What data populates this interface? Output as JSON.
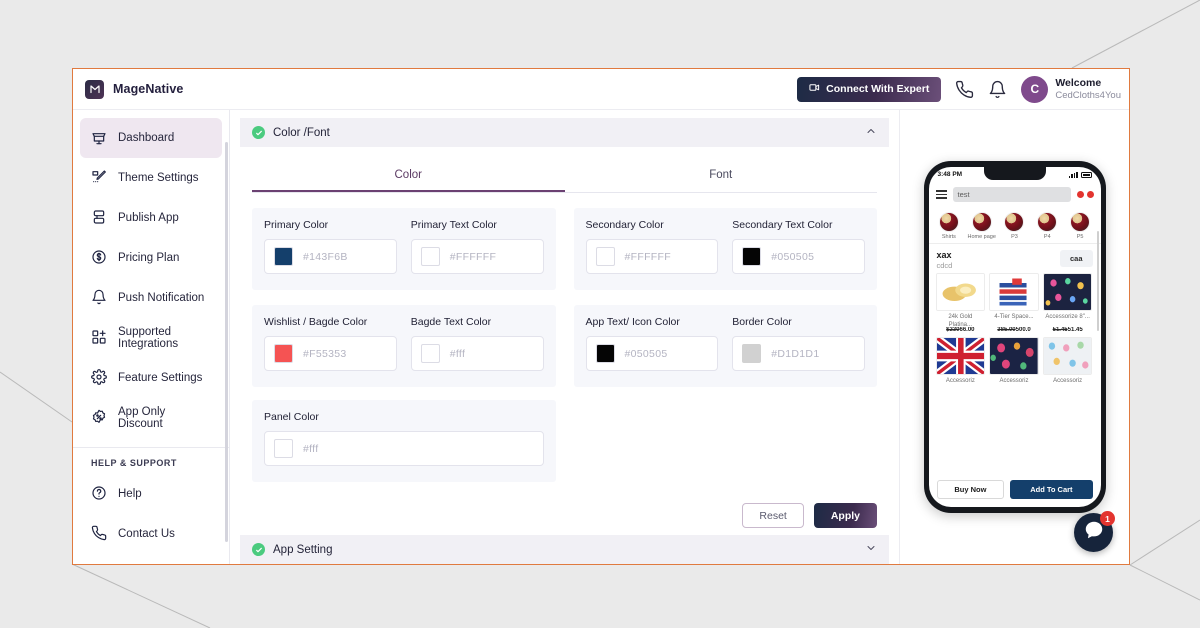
{
  "app": {
    "brand_name": "MageNative",
    "brand_icon": "magenative-logo-icon"
  },
  "header": {
    "expert_button": "Connect With Expert",
    "expert_icon": "video-camera-icon",
    "phone_icon": "phone-icon",
    "bell_icon": "bell-icon",
    "avatar_initial": "C",
    "welcome_label": "Welcome",
    "account_name": "CedCloths4You"
  },
  "sidebar": {
    "items": [
      {
        "label": "Dashboard",
        "icon": "dashboard-icon",
        "active": true
      },
      {
        "label": "Theme Settings",
        "icon": "theme-settings-icon",
        "active": false
      },
      {
        "label": "Publish App",
        "icon": "publish-app-icon",
        "active": false
      },
      {
        "label": "Pricing Plan",
        "icon": "pricing-plan-icon",
        "active": false
      },
      {
        "label": "Push Notification",
        "icon": "bell-icon",
        "active": false
      },
      {
        "label": "Supported Integrations",
        "icon": "integrations-icon",
        "active": false
      },
      {
        "label": "Feature Settings",
        "icon": "gear-icon",
        "active": false
      },
      {
        "label": "App Only Discount",
        "icon": "discount-icon",
        "active": false
      }
    ],
    "section_header": "HELP & SUPPORT",
    "support_items": [
      {
        "label": "Help",
        "icon": "question-circle-icon"
      },
      {
        "label": "Contact Us",
        "icon": "phone-icon"
      }
    ]
  },
  "accordions": {
    "color_font": {
      "title": "Color /Font",
      "status_icon": "check-circle-icon",
      "caret": "chevron-up-icon",
      "expanded": true
    },
    "app_setting": {
      "title": "App Setting",
      "status_icon": "check-circle-icon",
      "caret": "chevron-down-icon",
      "expanded": false
    }
  },
  "tabs": [
    {
      "label": "Color",
      "active": true
    },
    {
      "label": "Font",
      "active": false
    }
  ],
  "color_fields": {
    "group_1": [
      {
        "label": "Primary Color",
        "value": "#143F6B",
        "swatch": "#143f6b"
      },
      {
        "label": "Primary Text Color",
        "value": "#FFFFFF",
        "swatch": "#ffffff"
      }
    ],
    "group_2": [
      {
        "label": "Secondary Color",
        "value": "#FFFFFF",
        "swatch": "#ffffff"
      },
      {
        "label": "Secondary Text Color",
        "value": "#050505",
        "swatch": "#050505"
      }
    ],
    "group_3": [
      {
        "label": "Wishlist / Bagde Color",
        "value": "#F55353",
        "swatch": "#f55353"
      },
      {
        "label": "Bagde Text Color",
        "value": "#fff",
        "swatch": "#ffffff"
      }
    ],
    "group_4": [
      {
        "label": "App Text/ Icon Color",
        "value": "#050505",
        "swatch": "#050505"
      },
      {
        "label": "Border Color",
        "value": "#D1D1D1",
        "swatch": "#d1d1d1"
      }
    ],
    "group_5": [
      {
        "label": "Panel Color",
        "value": "#fff",
        "swatch": "#ffffff"
      }
    ]
  },
  "actions": {
    "reset_label": "Reset",
    "apply_label": "Apply"
  },
  "preview": {
    "status_time": "3:48 PM",
    "signal_icon": "signal-bars-icon",
    "battery_icon": "battery-icon",
    "menu_icon": "hamburger-menu-icon",
    "search_value": "test",
    "nav_dot_icons": [
      "wishlist-dot-icon",
      "cart-dot-icon"
    ],
    "stories": [
      {
        "label": "Shirts"
      },
      {
        "label": "Home page"
      },
      {
        "label": "P3"
      },
      {
        "label": "P4"
      },
      {
        "label": "P5"
      }
    ],
    "section_title": "xax",
    "section_subtitle": "cdcd",
    "section_button": "caa",
    "products_row1": [
      {
        "name": "24k Gold Platina...",
        "old_price": "$230",
        "price": "66.00"
      },
      {
        "name": "4-Tier Space...",
        "old_price": "385.00",
        "price": "500.0"
      },
      {
        "name": "Accessorize 8\"...",
        "old_price": "51.45",
        "price": "51.45"
      }
    ],
    "products_row2": [
      {
        "name": "Accessoriz"
      },
      {
        "name": "Accessoriz"
      },
      {
        "name": "Accessoriz"
      }
    ],
    "buy_now_label": "Buy Now",
    "add_to_cart_label": "Add To Cart"
  },
  "chat_widget": {
    "icon": "chat-bubble-icon",
    "badge_count": "1"
  },
  "colors": {
    "accent_orange": "#e07a3f",
    "brand_purple": "#6b4172",
    "success_green": "#4bcb7f",
    "page_bg": "#eaeaea"
  }
}
